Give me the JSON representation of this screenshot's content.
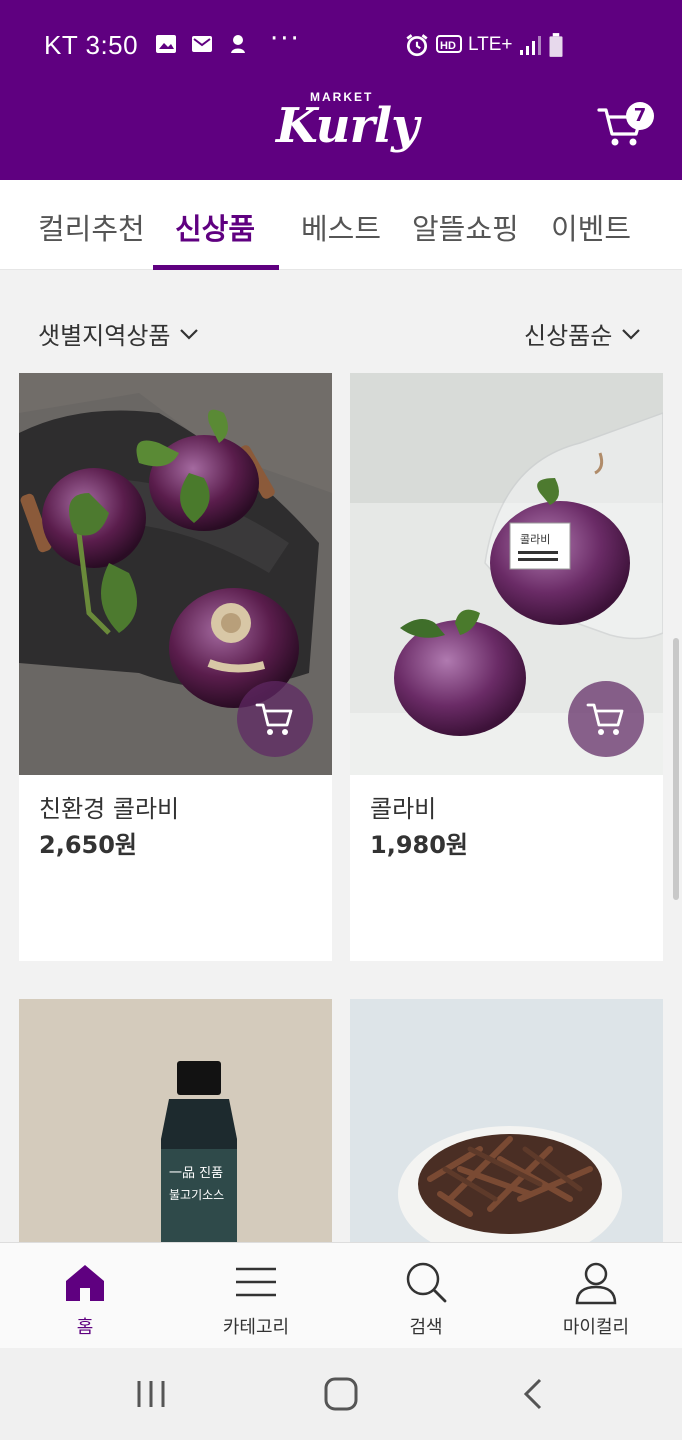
{
  "status_bar": {
    "carrier_time": "KT 3:50",
    "more": "···",
    "network": "LTE+"
  },
  "header": {
    "logo_small": "MARKET",
    "logo_big": "Kurly",
    "cart_count": "7",
    "brand_color": "#5f0080"
  },
  "tabs": [
    {
      "label": "컬리추천",
      "active": false
    },
    {
      "label": "신상품",
      "active": true
    },
    {
      "label": "베스트",
      "active": false
    },
    {
      "label": "알뜰쇼핑",
      "active": false
    },
    {
      "label": "이벤트",
      "active": false
    }
  ],
  "filters": {
    "region": "샛별지역상품",
    "sort": "신상품순"
  },
  "products": [
    {
      "name": "친환경 콜라비",
      "price": "2,650원",
      "image": "kohlrabi-on-cloth"
    },
    {
      "name": "콜라비",
      "price": "1,980원",
      "image": "kohlrabi-in-bag"
    },
    {
      "name": "",
      "price": "",
      "image": "bulgogi-sauce-bottle"
    },
    {
      "name": "",
      "price": "",
      "image": "braised-fernbrake-plate"
    }
  ],
  "bottle_label": {
    "line1": "一品 진품",
    "line2": "불고기소스"
  },
  "bag_label": "콜라비",
  "bottom_nav": [
    {
      "label": "홈",
      "icon": "home-icon",
      "active": true
    },
    {
      "label": "카테고리",
      "icon": "menu-icon",
      "active": false
    },
    {
      "label": "검색",
      "icon": "search-icon",
      "active": false
    },
    {
      "label": "마이컬리",
      "icon": "user-icon",
      "active": false
    }
  ]
}
